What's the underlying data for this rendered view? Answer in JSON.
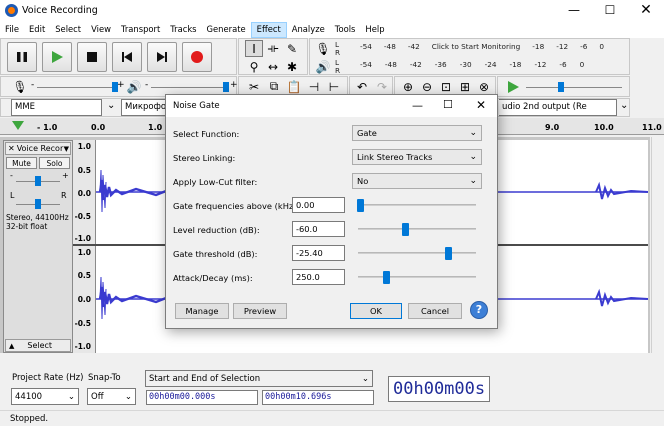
{
  "window": {
    "title": "Voice Recording"
  },
  "menu": [
    "File",
    "Edit",
    "Select",
    "View",
    "Transport",
    "Tracks",
    "Generate",
    "Effect",
    "Analyze",
    "Tools",
    "Help"
  ],
  "menu_active": "Effect",
  "transport": {
    "buttons": [
      "pause",
      "play",
      "stop",
      "skip-start",
      "skip-end",
      "record"
    ]
  },
  "meters": {
    "record_scale": [
      "-54",
      "-48",
      "-42",
      "Click to Start Monitoring",
      "-18",
      "-12",
      "-6",
      "0"
    ],
    "play_scale": [
      "-54",
      "-48",
      "-42",
      "-36",
      "-30",
      "-24",
      "-18",
      "-12",
      "-6",
      "0"
    ],
    "channels": [
      "L",
      "R"
    ]
  },
  "mixer": {
    "mic_minus": "-",
    "mic_plus": "+",
    "spk_minus": "-",
    "spk_plus": "+"
  },
  "device": {
    "host": "MME",
    "input": "Микрофон",
    "output": "udio 2nd output (Re"
  },
  "ruler": [
    "- 1.0",
    "0.0",
    "1.0",
    "9.0",
    "10.0",
    "11.0"
  ],
  "track": {
    "name": "Voice Recor",
    "mute": "Mute",
    "solo": "Solo",
    "pan_l": "L",
    "pan_r": "R",
    "gain_minus": "-",
    "gain_plus": "+",
    "info1": "Stereo, 44100Hz",
    "info2": "32-bit float",
    "select": "Select",
    "ch1_scale": [
      "1.0",
      "0.5",
      "0.0",
      "-0.5",
      "-1.0"
    ],
    "ch2_scale": [
      "1.0",
      "0.5",
      "0.0",
      "-0.5",
      "-1.0"
    ]
  },
  "dialog": {
    "title": "Noise Gate",
    "rows": [
      {
        "label": "Select Function:",
        "value": "Gate"
      },
      {
        "label": "Stereo Linking:",
        "value": "Link Stereo Tracks"
      },
      {
        "label": "Apply Low-Cut filter:",
        "value": "No"
      }
    ],
    "params": [
      {
        "label": "Gate frequencies above (kHz):",
        "value": "0.00",
        "level": 0.02
      },
      {
        "label": "Level reduction (dB):",
        "value": "-60.0",
        "level": 0.4
      },
      {
        "label": "Gate threshold (dB):",
        "value": "-25.40",
        "level": 0.76
      },
      {
        "label": "Attack/Decay (ms):",
        "value": "250.0",
        "level": 0.24
      }
    ],
    "buttons": {
      "manage": "Manage",
      "preview": "Preview",
      "ok": "OK",
      "cancel": "Cancel",
      "help": "?"
    }
  },
  "selection": {
    "rate_label": "Project Rate (Hz)",
    "rate_value": "44100",
    "snap_label": "Snap-To",
    "snap_value": "Off",
    "mode": "Start and End of Selection",
    "start": "00h00m00.000s",
    "end": "00h00m10.696s",
    "big_time": "00h00m00s"
  },
  "status": "Stopped.",
  "colors": {
    "accent": "#0078d7",
    "wave": "#3b3bd0",
    "record": "#e21b1b",
    "play": "#3ea63e"
  }
}
